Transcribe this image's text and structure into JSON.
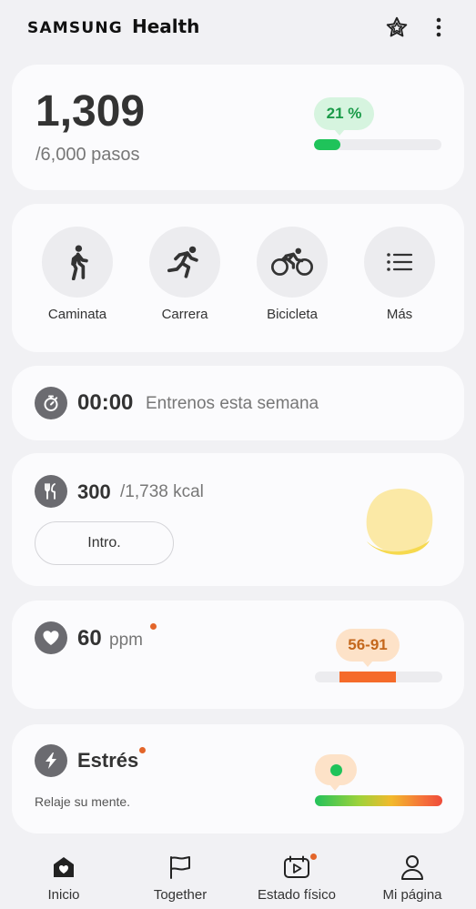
{
  "app": {
    "brand_samsung": "SAMSUNG",
    "brand_health": "Health"
  },
  "header": {
    "star_icon": "star-icon",
    "more_icon": "more-vertical-icon"
  },
  "steps": {
    "value": "1,309",
    "goal_text": "/6,000 pasos",
    "percent_label": "21 %",
    "progress": 0.21
  },
  "activities": [
    {
      "label": "Caminata",
      "icon": "walking-icon"
    },
    {
      "label": "Carrera",
      "icon": "running-icon"
    },
    {
      "label": "Bicicleta",
      "icon": "cycling-icon"
    },
    {
      "label": "Más",
      "icon": "list-icon"
    }
  ],
  "workouts": {
    "time": "00:00",
    "label": "Entrenos esta semana",
    "icon": "stopwatch-icon"
  },
  "food": {
    "value": "300",
    "goal_text": "/1,738 kcal",
    "button_label": "Intro.",
    "icon": "fork-knife-icon"
  },
  "heart": {
    "value": "60",
    "unit": "ppm",
    "range_label": "56-91",
    "icon": "heart-icon"
  },
  "stress": {
    "title": "Estrés",
    "message": "Relaje su mente.",
    "icon": "lightning-icon"
  },
  "nav": [
    {
      "label": "Inicio",
      "icon": "home-icon"
    },
    {
      "label": "Together",
      "icon": "flag-icon"
    },
    {
      "label": "Estado físico",
      "icon": "fitness-video-icon"
    },
    {
      "label": "Mi página",
      "icon": "person-icon"
    }
  ],
  "colors": {
    "accent_green": "#1fc35a",
    "heart_orange": "#f56b2a",
    "badge_green_bg": "#d6f4df",
    "badge_orange_bg": "#fde2c8",
    "notification_dot": "#e3652a"
  }
}
